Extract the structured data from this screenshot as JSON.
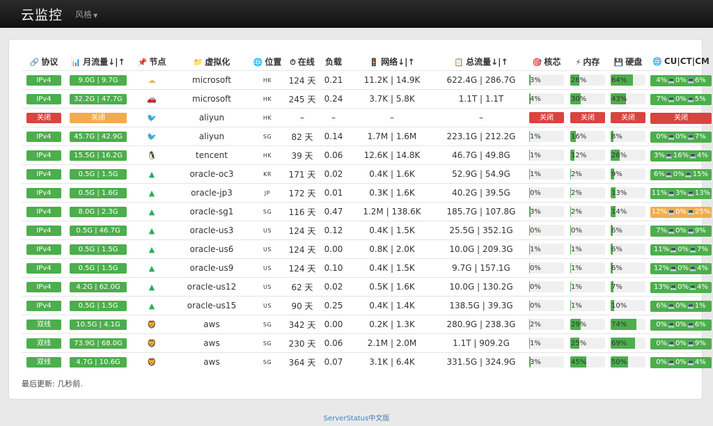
{
  "navbar": {
    "brand": "云监控",
    "style_menu": "风格"
  },
  "table": {
    "headers": [
      "协议",
      "月流量↓|↑",
      "节点",
      "虚拟化",
      "位置",
      "在线",
      "负载",
      "网络↓|↑",
      "总流量↓|↑",
      "核芯",
      "内存",
      "硬盘",
      "CU|CT|CM"
    ],
    "rows": [
      {
        "proto": "IPv4",
        "ps": "g",
        "traffic": "9.0G | 9.7G",
        "ts": "g",
        "node": "cloud",
        "virt": "microsoft",
        "loc": "HK",
        "uptime": "124 天",
        "load": "0.21",
        "net": "11.2K | 14.9K",
        "total": "622.4G | 286.7G",
        "cpu": "3%",
        "mem": "26%",
        "hdd": "64%",
        "cu": "4%",
        "ctv": "0%",
        "cm": "6%",
        "cs": "g"
      },
      {
        "proto": "IPv4",
        "ps": "g",
        "traffic": "32.2G | 47.7G",
        "ts": "g",
        "node": "car",
        "virt": "microsoft",
        "loc": "HK",
        "uptime": "245 天",
        "load": "0.24",
        "net": "3.7K | 5.8K",
        "total": "1.1T | 1.1T",
        "cpu": "4%",
        "mem": "30%",
        "hdd": "43%",
        "cu": "7%",
        "ctv": "0%",
        "cm": "5%",
        "cs": "g"
      },
      {
        "proto": "关闭",
        "ps": "r",
        "traffic": "关闭",
        "ts": "o",
        "node": "bird",
        "virt": "aliyun",
        "loc": "HK",
        "uptime": "–",
        "load": "–",
        "net": "–",
        "total": "–",
        "cpu": "关闭",
        "mem": "关闭",
        "hdd": "关闭",
        "cu": "关闭",
        "ctv": "",
        "cm": "",
        "cs": "r"
      },
      {
        "proto": "IPv4",
        "ps": "g",
        "traffic": "45.7G | 42.9G",
        "ts": "g",
        "node": "bird",
        "virt": "aliyun",
        "loc": "SG",
        "uptime": "82 天",
        "load": "0.14",
        "net": "1.7M | 1.6M",
        "total": "223.1G | 212.2G",
        "cpu": "1%",
        "mem": "16%",
        "hdd": "8%",
        "cu": "0%",
        "ctv": "0%",
        "cm": "7%",
        "cs": "g"
      },
      {
        "proto": "IPv4",
        "ps": "g",
        "traffic": "15.5G | 16.2G",
        "ts": "g",
        "node": "penguin",
        "virt": "tencent",
        "loc": "HK",
        "uptime": "39 天",
        "load": "0.06",
        "net": "12.6K | 14.8K",
        "total": "46.7G | 49.8G",
        "cpu": "1%",
        "mem": "12%",
        "hdd": "26%",
        "cu": "3%",
        "ctv": "16%",
        "cm": "4%",
        "cs": "g"
      },
      {
        "proto": "IPv4",
        "ps": "g",
        "traffic": "0.5G | 1.5G",
        "ts": "g",
        "node": "hill",
        "virt": "oracle-oc3",
        "loc": "KR",
        "uptime": "171 天",
        "load": "0.02",
        "net": "0.4K | 1.6K",
        "total": "52.9G | 54.9G",
        "cpu": "1%",
        "mem": "2%",
        "hdd": "9%",
        "cu": "6%",
        "ctv": "0%",
        "cm": "15%",
        "cs": "g"
      },
      {
        "proto": "IPv4",
        "ps": "g",
        "traffic": "0.5G | 1.6G",
        "ts": "g",
        "node": "hill",
        "virt": "oracle-jp3",
        "loc": "JP",
        "uptime": "172 天",
        "load": "0.01",
        "net": "0.3K | 1.6K",
        "total": "40.2G | 39.5G",
        "cpu": "0%",
        "mem": "2%",
        "hdd": "13%",
        "cu": "11%",
        "ctv": "3%",
        "cm": "13%",
        "cs": "g"
      },
      {
        "proto": "IPv4",
        "ps": "g",
        "traffic": "8.0G | 2.3G",
        "ts": "g",
        "node": "hill",
        "virt": "oracle-sg1",
        "loc": "SG",
        "uptime": "116 天",
        "load": "0.47",
        "net": "1.2M | 138.6K",
        "total": "185.7G | 107.8G",
        "cpu": "3%",
        "mem": "2%",
        "hdd": "14%",
        "cu": "12%",
        "ctv": "0%",
        "cm": "25%",
        "cs": "o"
      },
      {
        "proto": "IPv4",
        "ps": "g",
        "traffic": "0.5G | 46.7G",
        "ts": "g",
        "node": "hill",
        "virt": "oracle-us3",
        "loc": "US",
        "uptime": "124 天",
        "load": "0.12",
        "net": "0.4K | 1.5K",
        "total": "25.5G | 352.1G",
        "cpu": "0%",
        "mem": "0%",
        "hdd": "6%",
        "cu": "7%",
        "ctv": "0%",
        "cm": "9%",
        "cs": "g"
      },
      {
        "proto": "IPv4",
        "ps": "g",
        "traffic": "0.5G | 1.5G",
        "ts": "g",
        "node": "hill",
        "virt": "oracle-us6",
        "loc": "US",
        "uptime": "124 天",
        "load": "0.00",
        "net": "0.8K | 2.0K",
        "total": "10.0G | 209.3G",
        "cpu": "1%",
        "mem": "1%",
        "hdd": "6%",
        "cu": "11%",
        "ctv": "0%",
        "cm": "7%",
        "cs": "g"
      },
      {
        "proto": "IPv4",
        "ps": "g",
        "traffic": "0.5G | 1.5G",
        "ts": "g",
        "node": "hill",
        "virt": "oracle-us9",
        "loc": "US",
        "uptime": "124 天",
        "load": "0.10",
        "net": "0.4K | 1.5K",
        "total": "9.7G | 157.1G",
        "cpu": "0%",
        "mem": "1%",
        "hdd": "6%",
        "cu": "12%",
        "ctv": "0%",
        "cm": "4%",
        "cs": "g"
      },
      {
        "proto": "IPv4",
        "ps": "g",
        "traffic": "4.2G | 62.0G",
        "ts": "g",
        "node": "hill",
        "virt": "oracle-us12",
        "loc": "US",
        "uptime": "62 天",
        "load": "0.02",
        "net": "0.5K | 1.6K",
        "total": "10.0G | 130.2G",
        "cpu": "0%",
        "mem": "1%",
        "hdd": "7%",
        "cu": "13%",
        "ctv": "0%",
        "cm": "4%",
        "cs": "g"
      },
      {
        "proto": "IPv4",
        "ps": "g",
        "traffic": "0.5G | 1.5G",
        "ts": "g",
        "node": "hill",
        "virt": "oracle-us15",
        "loc": "US",
        "uptime": "90 天",
        "load": "0.25",
        "net": "0.4K | 1.4K",
        "total": "138.5G | 39.3G",
        "cpu": "0%",
        "mem": "1%",
        "hdd": "10%",
        "cu": "6%",
        "ctv": "0%",
        "cm": "1%",
        "cs": "g"
      },
      {
        "proto": "双线",
        "ps": "g",
        "traffic": "10.5G | 4.1G",
        "ts": "g",
        "node": "lion",
        "virt": "aws",
        "loc": "SG",
        "uptime": "342 天",
        "load": "0.00",
        "net": "0.2K | 1.3K",
        "total": "280.9G | 238.3G",
        "cpu": "2%",
        "mem": "29%",
        "hdd": "74%",
        "cu": "0%",
        "ctv": "0%",
        "cm": "6%",
        "cs": "g"
      },
      {
        "proto": "双线",
        "ps": "g",
        "traffic": "73.9G | 68.0G",
        "ts": "g",
        "node": "lion",
        "virt": "aws",
        "loc": "SG",
        "uptime": "230 天",
        "load": "0.06",
        "net": "2.1M | 2.0M",
        "total": "1.1T | 909.2G",
        "cpu": "1%",
        "mem": "25%",
        "hdd": "69%",
        "cu": "0%",
        "ctv": "0%",
        "cm": "9%",
        "cs": "g"
      },
      {
        "proto": "双线",
        "ps": "g",
        "traffic": "4.7G | 10.6G",
        "ts": "g",
        "node": "lion",
        "virt": "aws",
        "loc": "SG",
        "uptime": "364 天",
        "load": "0.07",
        "net": "3.1K | 6.4K",
        "total": "331.5G | 324.9G",
        "cpu": "3%",
        "mem": "45%",
        "hdd": "50%",
        "cu": "0%",
        "ctv": "0%",
        "cm": "4%",
        "cs": "g"
      }
    ]
  },
  "last_update": "最后更新: 几秒前.",
  "footer": "ServerStatus中文版"
}
